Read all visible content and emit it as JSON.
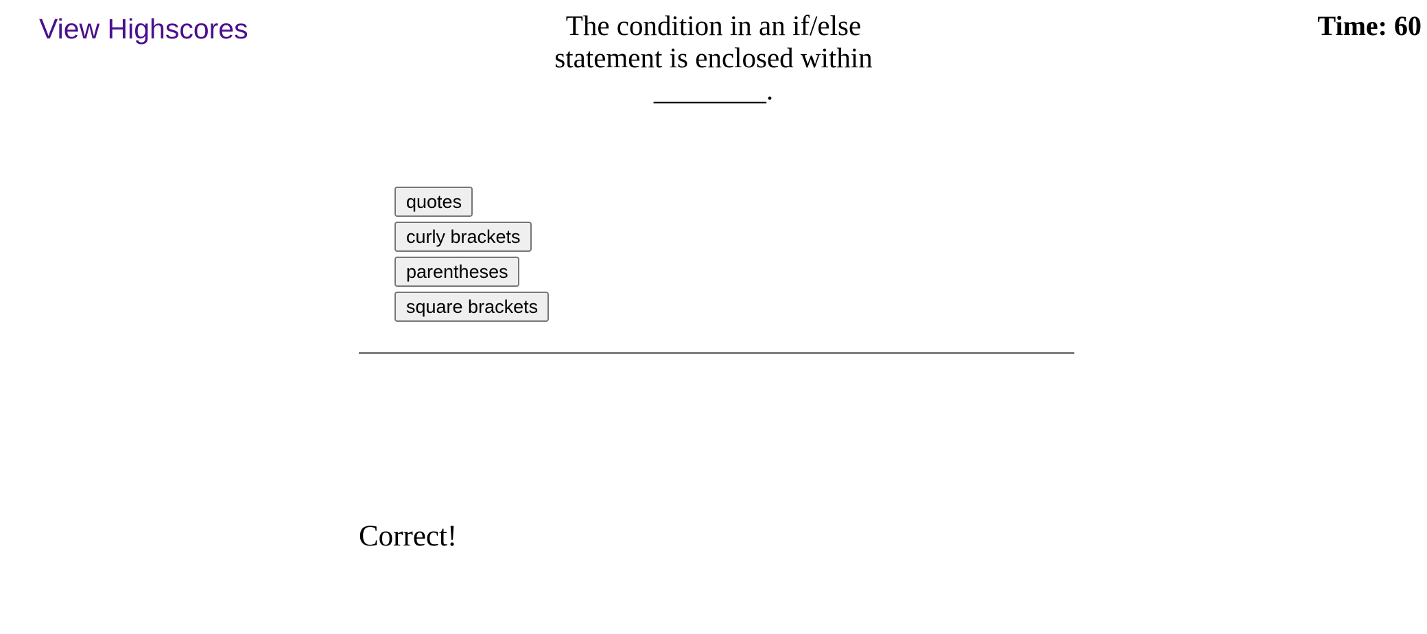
{
  "header": {
    "highscores_link": "View Highscores",
    "timer": "Time: 60"
  },
  "quiz": {
    "question": "The condition in an if/else statement is enclosed within ________.",
    "choices": [
      {
        "label": "quotes"
      },
      {
        "label": "curly brackets"
      },
      {
        "label": "parentheses"
      },
      {
        "label": "square brackets"
      }
    ],
    "feedback": "Correct!"
  },
  "colors": {
    "link": "#4b0f8c",
    "button_bg": "#efefef",
    "button_border": "#767676",
    "divider": "#808080"
  }
}
